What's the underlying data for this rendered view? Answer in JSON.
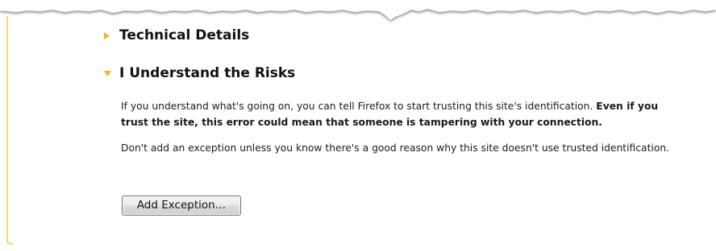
{
  "sections": [
    {
      "title": "Technical Details",
      "expanded": false,
      "arrow_icon": "collapsed-triangle-icon"
    },
    {
      "title": "I Understand the Risks",
      "expanded": true,
      "arrow_icon": "expanded-triangle-icon",
      "paragraph1_normal": "If you understand what's going on, you can tell Firefox to start trusting this site's identification. ",
      "paragraph1_bold": "Even if you trust the site, this error could mean that someone is tampering with your connection.",
      "paragraph2": "Don't add an exception unless you know there's a good reason why this site doesn't use trusted identification.",
      "button_label": "Add Exception…"
    }
  ],
  "colors": {
    "arrow": "#f2b622",
    "border": "#f6d77a",
    "text": "#1a1a1a"
  }
}
